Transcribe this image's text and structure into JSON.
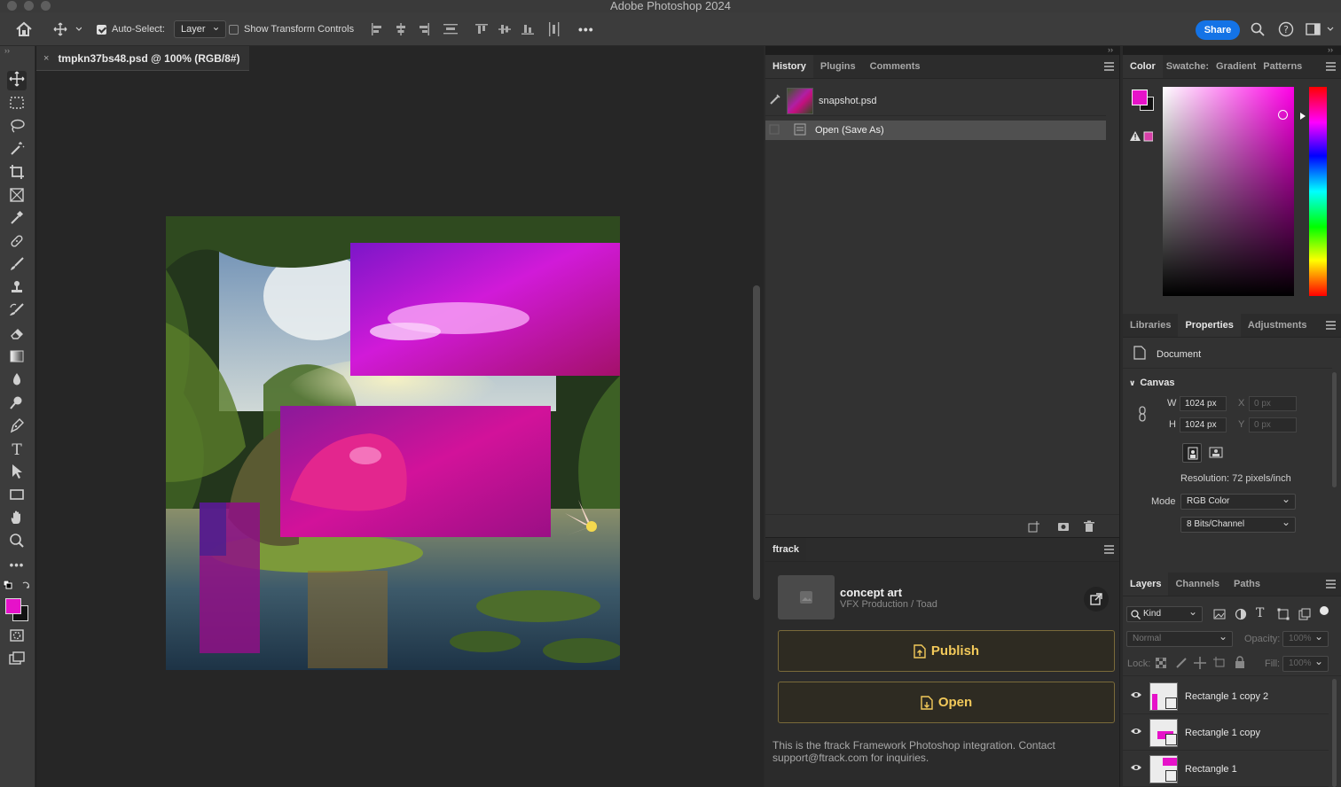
{
  "app": {
    "title": "Adobe Photoshop 2024"
  },
  "options_bar": {
    "auto_select_label": "Auto-Select:",
    "auto_select_checked": true,
    "auto_select_target": "Layer",
    "show_transform_label": "Show Transform Controls",
    "show_transform_checked": false,
    "more": "•••",
    "share_label": "Share"
  },
  "document": {
    "tab_title": "tmpkn37bs48.psd @ 100% (RGB/8#)",
    "close": "×"
  },
  "history": {
    "tabs": [
      "History",
      "Plugins",
      "Comments"
    ],
    "active_tab": "History",
    "snapshot_name": "snapshot.psd",
    "steps": [
      "Open (Save As)"
    ]
  },
  "ftrack": {
    "tab": "ftrack",
    "asset_name": "concept art",
    "asset_context": "VFX Production / Toad",
    "publish_label": "Publish",
    "open_label": "Open",
    "footer_text": "This is the ftrack Framework Photoshop integration. Contact support@ftrack.com for inquiries."
  },
  "color_panel": {
    "tabs": [
      "Color",
      "Swatche:",
      "Gradient",
      "Patterns"
    ],
    "active_tab": "Color",
    "foreground": "#e612c9",
    "background": "#111111",
    "hue_color": "#ff00e6"
  },
  "properties": {
    "tabs": [
      "Libraries",
      "Properties",
      "Adjustments"
    ],
    "active_tab": "Properties",
    "document_label": "Document",
    "canvas_section": "Canvas",
    "w_label": "W",
    "w_value": "1024 px",
    "h_label": "H",
    "h_value": "1024 px",
    "x_label": "X",
    "x_placeholder": "0 px",
    "y_label": "Y",
    "y_placeholder": "0 px",
    "resolution": "Resolution: 72 pixels/inch",
    "mode_label": "Mode",
    "mode_value": "RGB Color",
    "depth_value": "8 Bits/Channel"
  },
  "layers": {
    "tabs": [
      "Layers",
      "Channels",
      "Paths"
    ],
    "active_tab": "Layers",
    "filter_kind": "Kind",
    "blend_mode": "Normal",
    "opacity_label": "Opacity:",
    "opacity_value": "100%",
    "lock_label": "Lock:",
    "fill_label": "Fill:",
    "fill_value": "100%",
    "items": [
      {
        "name": "Rectangle 1 copy 2",
        "visible": true
      },
      {
        "name": "Rectangle 1 copy",
        "visible": true
      },
      {
        "name": "Rectangle 1",
        "visible": true
      }
    ]
  }
}
